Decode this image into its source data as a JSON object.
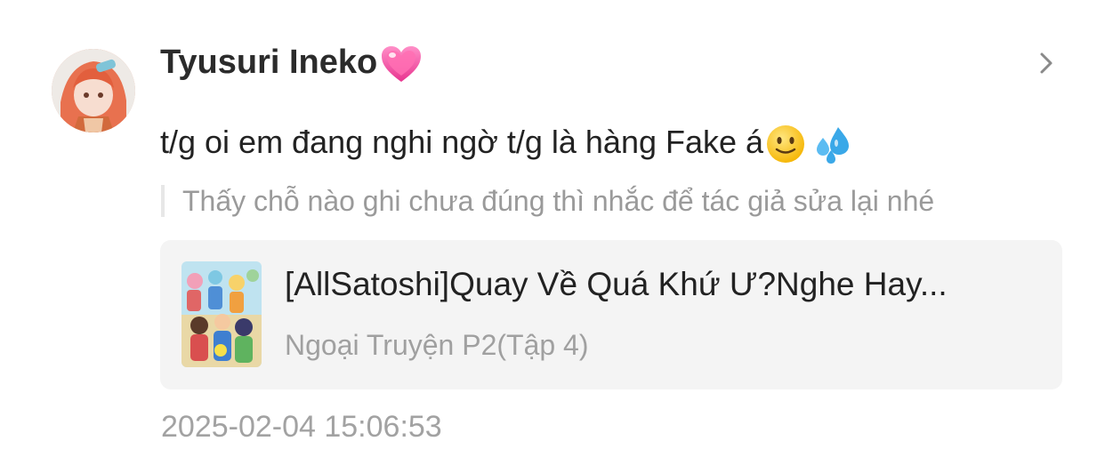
{
  "comment_item": {
    "avatar_icon": "user-avatar",
    "username": "Tyusuri Ineko",
    "username_emoji": "sparkling-heart-icon",
    "comment_text": "t/g oi em đang nghi ngờ t/g là hàng Fake á",
    "comment_emojis": [
      "slightly-smiling-face-icon",
      "sweat-droplets-icon"
    ],
    "quote_text": "Thấy chỗ nào ghi chưa đúng thì nhắc để tác giả sửa lại nhé",
    "story_card": {
      "cover_icon": "story-cover-image",
      "title": "[AllSatoshi]Quay Về Quá Khứ Ư?Nghe Hay...",
      "chapter": "Ngoại Truyện P2(Tập 4)"
    },
    "timestamp": "2025-02-04 15:06:53",
    "chevron_icon": "chevron-right-icon"
  }
}
